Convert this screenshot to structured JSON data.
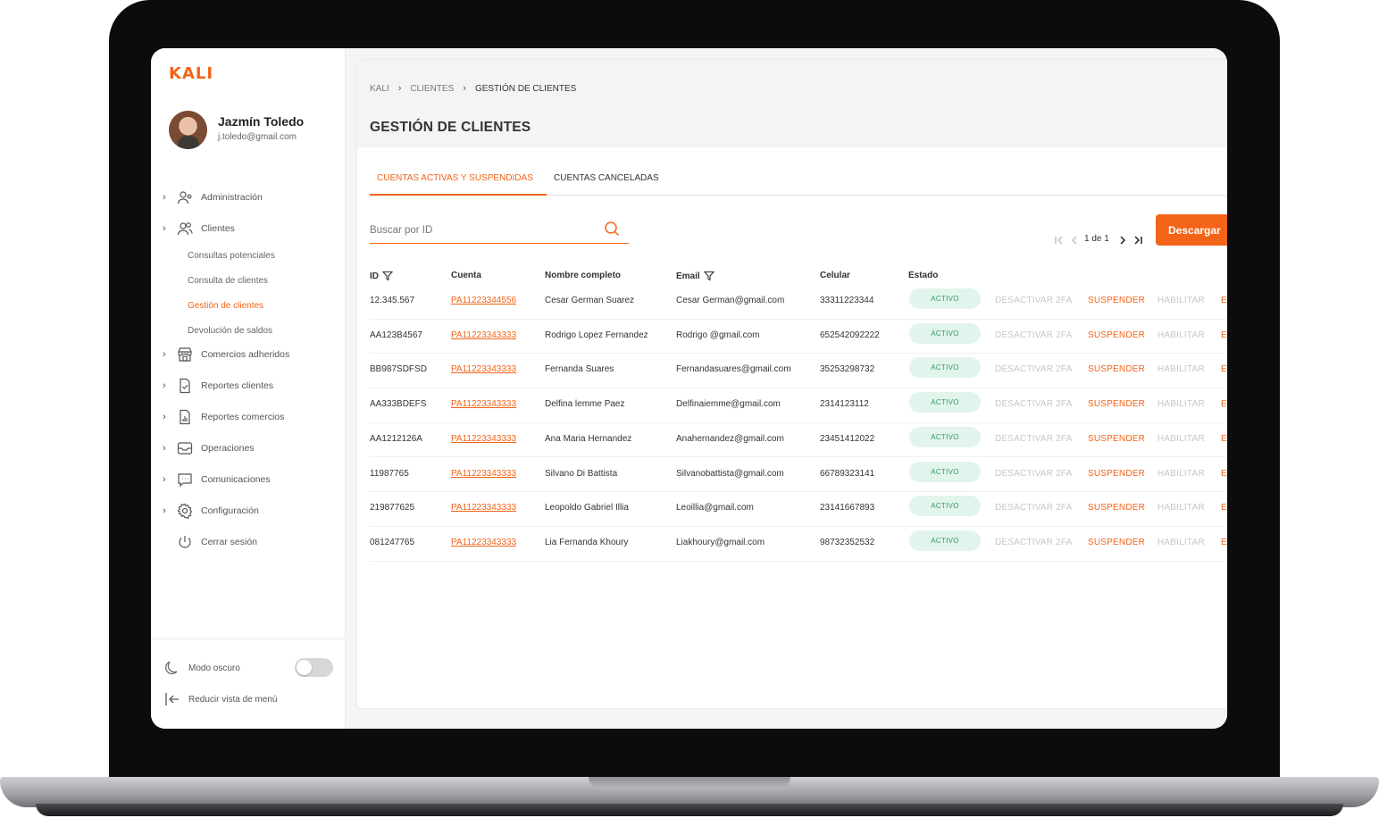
{
  "app": {
    "logo": "KALI"
  },
  "profile": {
    "name": "Jazmín Toledo",
    "email": "j.toledo@gmail.com"
  },
  "sidebar": {
    "items": [
      {
        "label": "Administración",
        "icon": "user-gear-icon",
        "has_chevron": true
      },
      {
        "label": "Clientes",
        "icon": "users-icon",
        "has_chevron": true
      },
      {
        "label": "Comercios adheridos",
        "icon": "store-icon",
        "has_chevron": true
      },
      {
        "label": "Reportes clientes",
        "icon": "report-check-icon",
        "has_chevron": true
      },
      {
        "label": "Reportes comercios",
        "icon": "report-chart-icon",
        "has_chevron": true
      },
      {
        "label": "Operaciones",
        "icon": "inbox-icon",
        "has_chevron": true
      },
      {
        "label": "Comunicaciones",
        "icon": "chat-icon",
        "has_chevron": true
      },
      {
        "label": "Configuración",
        "icon": "gear-icon",
        "has_chevron": true
      },
      {
        "label": "Cerrar sesión",
        "icon": "power-icon",
        "has_chevron": false
      }
    ],
    "subitems": [
      {
        "label": "Consultas potenciales",
        "active": false
      },
      {
        "label": "Consulta de clientes",
        "active": false
      },
      {
        "label": "Gestión de clientes",
        "active": true
      },
      {
        "label": "Devolución de saldos",
        "active": false
      }
    ],
    "footer": {
      "dark_mode_label": "Modo oscuro",
      "dark_mode_on": false,
      "collapse_label": "Reducir vista de menú"
    }
  },
  "breadcrumb": [
    "KALI",
    "CLIENTES",
    "GESTIÓN DE CLIENTES"
  ],
  "page_title": "GESTIÓN DE CLIENTES",
  "tabs": [
    {
      "label": "CUENTAS ACTIVAS Y SUSPENDIDAS",
      "active": true
    },
    {
      "label": "CUENTAS CANCELADAS",
      "active": false
    }
  ],
  "search": {
    "placeholder": "Buscar por ID",
    "value": ""
  },
  "pagination": {
    "label": "1 de 1"
  },
  "download_label": "Descargar",
  "table": {
    "columns": [
      "ID",
      "Cuenta",
      "Nombre completo",
      "Email",
      "Celular",
      "Estado"
    ],
    "actions": {
      "disable_2fa": "DESACTIVAR 2FA",
      "suspend": "SUSPENDER",
      "enable": "HABILITAR",
      "more": "E"
    },
    "rows": [
      {
        "id": "12.345.567",
        "account": "PA11223344556",
        "name": "Cesar German Suarez",
        "email": "Cesar German@gmail.com",
        "phone": "33311223344",
        "status": "ACTIVO"
      },
      {
        "id": "AA123B4567",
        "account": "PA11223343333",
        "name": "Rodrigo Lopez Fernandez",
        "email": "Rodrigo @gmail.com",
        "phone": "652542092222",
        "status": "ACTIVO"
      },
      {
        "id": "BB987SDFSD",
        "account": "PA11223343333",
        "name": "Fernanda Suares",
        "email": "Fernandasuares@gmail.com",
        "phone": "35253298732",
        "status": "ACTIVO"
      },
      {
        "id": "AA333BDEFS",
        "account": "PA11223343333",
        "name": "Delfina lemme Paez",
        "email": "Delfinaiemme@gmail.com",
        "phone": "2314123112",
        "status": "ACTIVO"
      },
      {
        "id": "AA1212126A",
        "account": "PA11223343333",
        "name": "Ana Maria Hernandez",
        "email": "Anahernandez@gmail.com",
        "phone": "23451412022",
        "status": "ACTIVO"
      },
      {
        "id": "11987765",
        "account": "PA11223343333",
        "name": "Silvano Di Battista",
        "email": "Silvanobattista@gmail.com",
        "phone": "66789323141",
        "status": "ACTIVO"
      },
      {
        "id": "219877625",
        "account": "PA11223343333",
        "name": "Leopoldo Gabriel Illia",
        "email": "Leoillia@gmail.com",
        "phone": "23141667893",
        "status": "ACTIVO"
      },
      {
        "id": "081247765",
        "account": "PA11223343333",
        "name": "Lia Fernanda Khoury",
        "email": "Liakhoury@gmail.com",
        "phone": "98732352532",
        "status": "ACTIVO"
      }
    ]
  },
  "colors": {
    "accent": "#f26418",
    "active_badge_bg": "#e2f5ec",
    "active_badge_text": "#2f9c5e",
    "disabled_action": "#c7c7c7"
  }
}
